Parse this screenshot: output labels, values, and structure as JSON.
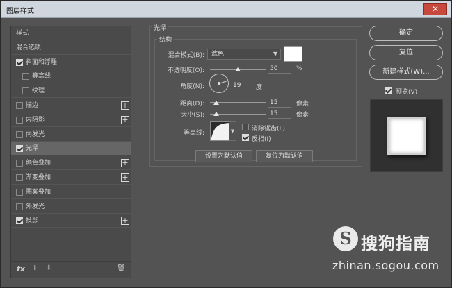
{
  "window": {
    "title": "图层样式",
    "close_glyph": "✕"
  },
  "left_panel": {
    "items": [
      {
        "label": "样式",
        "checkbox": null,
        "plus": false,
        "selected": false,
        "indent": false
      },
      {
        "label": "混合选项",
        "checkbox": null,
        "plus": false,
        "selected": false,
        "indent": false
      },
      {
        "label": "斜面和浮雕",
        "checkbox": true,
        "plus": false,
        "selected": false,
        "indent": false
      },
      {
        "label": "等高线",
        "checkbox": false,
        "plus": false,
        "selected": false,
        "indent": true
      },
      {
        "label": "纹理",
        "checkbox": false,
        "plus": false,
        "selected": false,
        "indent": true
      },
      {
        "label": "描边",
        "checkbox": false,
        "plus": true,
        "selected": false,
        "indent": false
      },
      {
        "label": "内阴影",
        "checkbox": false,
        "plus": true,
        "selected": false,
        "indent": false
      },
      {
        "label": "内发光",
        "checkbox": false,
        "plus": false,
        "selected": false,
        "indent": false
      },
      {
        "label": "光泽",
        "checkbox": true,
        "plus": false,
        "selected": true,
        "indent": false
      },
      {
        "label": "颜色叠加",
        "checkbox": false,
        "plus": true,
        "selected": false,
        "indent": false
      },
      {
        "label": "渐变叠加",
        "checkbox": false,
        "plus": true,
        "selected": false,
        "indent": false
      },
      {
        "label": "图案叠加",
        "checkbox": false,
        "plus": false,
        "selected": false,
        "indent": false
      },
      {
        "label": "外发光",
        "checkbox": false,
        "plus": false,
        "selected": false,
        "indent": false
      },
      {
        "label": "投影",
        "checkbox": true,
        "plus": true,
        "selected": false,
        "indent": false
      }
    ],
    "bottom": {
      "fx": "fx",
      "up": "⬆",
      "down": "⬇",
      "trash": "🗑"
    },
    "plus_glyph": "+"
  },
  "satin": {
    "group_title": "光泽",
    "subgroup_title": "结构",
    "blend_mode_label": "混合模式(B):",
    "blend_mode_value": "滤色",
    "opacity_label": "不透明度(O):",
    "opacity_value": "50",
    "opacity_unit": "%",
    "angle_label": "角度(N):",
    "angle_value": "19",
    "angle_unit": "度",
    "distance_label": "距离(D):",
    "distance_value": "15",
    "distance_unit": "像素",
    "size_label": "大小(S):",
    "size_value": "15",
    "size_unit": "像素",
    "contour_label": "等高线:",
    "antialias_label": "消除锯齿(L)",
    "antialias_checked": false,
    "invert_label": "反相(I)",
    "invert_checked": true,
    "color_swatch": "#ffffff",
    "make_default": "设置为默认值",
    "reset_default": "复位为默认值"
  },
  "right_panel": {
    "ok": "确定",
    "reset": "复位",
    "new_style": "新建样式(W)...",
    "preview_label": "预览(V)",
    "preview_checked": true
  },
  "watermark": {
    "logo_letter": "S",
    "brand": "搜狗指南",
    "url": "zhinan.sogou.com"
  }
}
